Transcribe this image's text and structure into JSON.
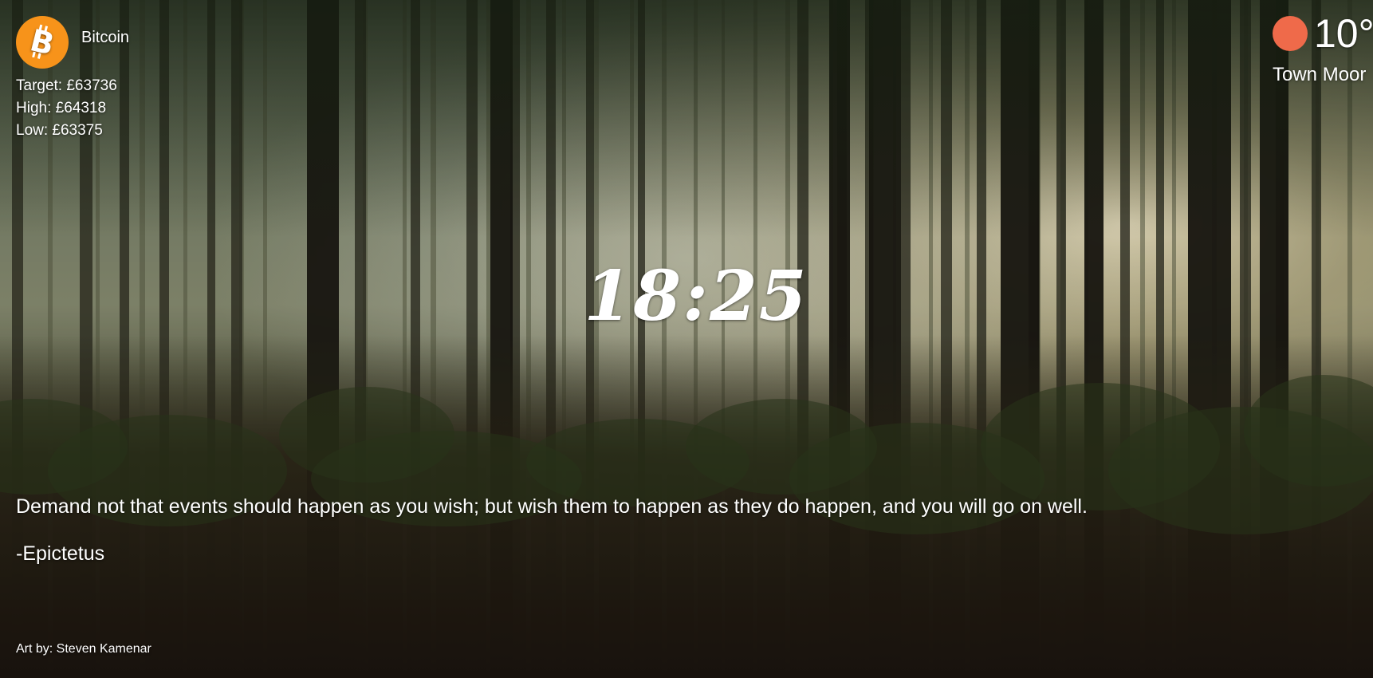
{
  "crypto": {
    "icon": "bitcoin-icon",
    "icon_color": "#f7931a",
    "name": "Bitcoin",
    "target": "Target: £63736",
    "high": "High: £64318",
    "low": "Low: £63375"
  },
  "weather": {
    "icon": "weather-dot-icon",
    "icon_color": "#ef6a4a",
    "temperature": "10°",
    "location": "Town Moor"
  },
  "clock": {
    "time": "18:25"
  },
  "quote": {
    "text": "Demand not that events should happen as you wish; but wish them to happen as they do happen, and you will go on well.",
    "author": "-Epictetus"
  },
  "credit": {
    "text": "Art by: Steven Kamenar"
  }
}
